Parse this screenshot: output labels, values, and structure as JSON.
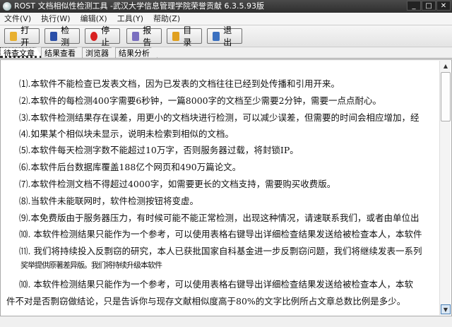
{
  "window": {
    "title": "ROST 文档相似性检测工具 -武汉大学信息管理学院荣誉贡献 6.3.5.93版"
  },
  "menu": [
    "文件(V)",
    "执行(W)",
    "编辑(X)",
    "工具(Y)",
    "帮助(Z)"
  ],
  "toolbar": [
    {
      "label": "打开",
      "icon": "folder-open-icon",
      "color": "#e8b030"
    },
    {
      "label": "检测",
      "icon": "save-disk-icon",
      "color": "#2a4fa8"
    },
    {
      "label": "停止",
      "icon": "stop-icon",
      "color": "#d82020"
    },
    {
      "label": "报告",
      "icon": "report-icon",
      "color": "#7a6fc0"
    },
    {
      "label": "目录",
      "icon": "directory-icon",
      "color": "#e0a020"
    },
    {
      "label": "退出",
      "icon": "exit-icon",
      "color": "#3a70c0"
    }
  ],
  "tabs": [
    "待查文章",
    "结果查看",
    "浏览器",
    "结果分析"
  ],
  "content": {
    "lines": [
      "⑴.本软件不能检查已发表文档，因为已发表的文档往往已经到处传播和引用开来。",
      "⑵.本软件的每检测400字需要6秒钟，一篇8000字的文档至少需要2分钟，需要一点点耐心。",
      "⑶.本软件检测结果存在误差，用更小的文档块进行检测，可以减少误差，但需要的时间会相应增加，经",
      "⑷.如果某个相似块未显示，说明未检索到相似的文档。",
      "⑸.本软件每天检测字数不能超过10万字，否则服务器过载，将封锁IP。",
      "⑹.本软件后台数据库覆盖188亿个网页和490万篇论文。",
      "⑺.本软件检测文档不得超过4000字，如需要更长的文档支持，需要购买收费版。",
      "⑻.当软件未能联网时，软件检测按钮将变虚。",
      "⑼.本免费版由于服务器压力，有时候可能不能正常检测，出现这种情况，请速联系我们，或者由单位出",
      "⑽. 本软件检测结果只能作为一个参考，可以使用表格右键导出详细检查结果发送给被检查本人，本软件",
      "⑾. 我们将持续投入反剽窃的研究，本人已获批国家自科基金进一步反剽窃问题，我们将继续发表一系列",
      "奖举提供原著差异版。我们将持续升级本软件",
      "⑽. 本软件检测结果只能作为一个参考，可以使用表格右键导出详细检查结果发送给被检查本人，本软",
      "件不对是否剽窃做结论，只是告诉你与现存文献相似度高于80%的文字比例所占文章总数比例是多少。"
    ]
  }
}
